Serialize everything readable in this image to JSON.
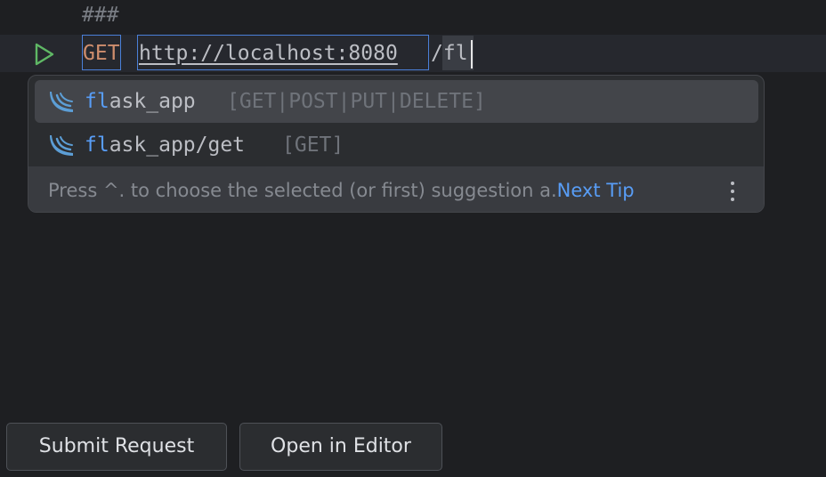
{
  "editor": {
    "separator_line": "###",
    "request": {
      "method": "GET",
      "url": "http://localhost:8080",
      "typed_suffix": "/fl"
    }
  },
  "completion_popup": {
    "items": [
      {
        "match": "fl",
        "rest": "ask_app",
        "methods": "[GET|POST|PUT|DELETE]",
        "icon": "flask-icon",
        "selected": true
      },
      {
        "match": "fl",
        "rest": "ask_app/get",
        "methods": "[GET]",
        "icon": "flask-icon",
        "selected": false
      }
    ],
    "tip": {
      "text": "Press ^. to choose the selected (or first) suggestion a.",
      "link": "Next Tip"
    }
  },
  "buttons": {
    "submit_label": "Submit Request",
    "open_label": "Open in Editor"
  },
  "colors": {
    "background": "#1e1f22",
    "current_line": "#26282e",
    "method": "#cf8e6d",
    "match_highlight": "#589df6",
    "run_icon": "#5fb865",
    "flask_icon": "#5c9ed6"
  }
}
